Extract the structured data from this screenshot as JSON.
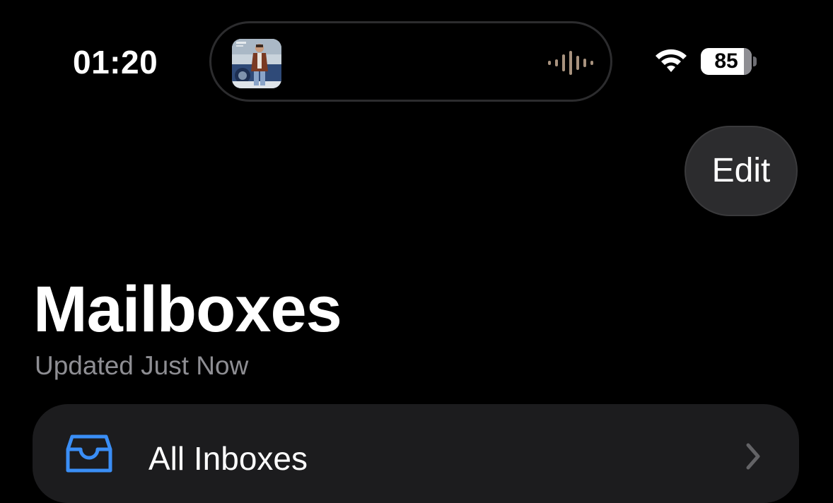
{
  "status_bar": {
    "time": "01:20",
    "battery_level": "85",
    "battery_fraction": 0.85,
    "wifi_icon": "wifi-icon"
  },
  "dynamic_island": {
    "activity": "now-playing",
    "album_art_icon": "album-art-thumbnail",
    "waveform_icon": "audio-waveform-icon"
  },
  "nav": {
    "edit_label": "Edit"
  },
  "header": {
    "title": "Mailboxes",
    "subtitle": "Updated Just Now"
  },
  "mailboxes": [
    {
      "label": "All Inboxes",
      "icon": "tray-inbox-icon",
      "accessory": "chevron-right-icon"
    }
  ],
  "colors": {
    "background": "#000000",
    "card": "#1c1c1e",
    "button": "#2c2c2e",
    "accent": "#3a8ef6",
    "secondary_text": "#8e8e93"
  }
}
